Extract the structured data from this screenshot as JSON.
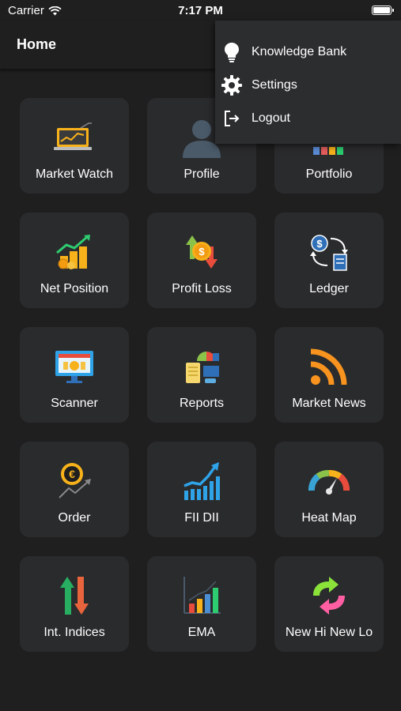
{
  "status_bar": {
    "carrier": "Carrier",
    "time": "7:17 PM"
  },
  "header": {
    "title": "Home"
  },
  "menu": {
    "items": [
      {
        "label": "Knowledge Bank",
        "icon": "lightbulb-icon"
      },
      {
        "label": "Settings",
        "icon": "gear-icon"
      },
      {
        "label": "Logout",
        "icon": "logout-icon"
      }
    ]
  },
  "tiles": [
    {
      "label": "Market Watch",
      "icon": "market-watch-icon"
    },
    {
      "label": "Profile",
      "icon": "profile-icon"
    },
    {
      "label": "Portfolio",
      "icon": "portfolio-icon"
    },
    {
      "label": "Net Position",
      "icon": "net-position-icon"
    },
    {
      "label": "Profit Loss",
      "icon": "profit-loss-icon"
    },
    {
      "label": "Ledger",
      "icon": "ledger-icon"
    },
    {
      "label": "Scanner",
      "icon": "scanner-icon"
    },
    {
      "label": "Reports",
      "icon": "reports-icon"
    },
    {
      "label": "Market News",
      "icon": "rss-icon"
    },
    {
      "label": "Order",
      "icon": "order-icon"
    },
    {
      "label": "FII DII",
      "icon": "fii-dii-icon"
    },
    {
      "label": "Heat Map",
      "icon": "heat-map-icon"
    },
    {
      "label": "Int. Indices",
      "icon": "int-indices-icon"
    },
    {
      "label": "EMA",
      "icon": "ema-icon"
    },
    {
      "label": "New Hi New Lo",
      "icon": "new-hi-new-lo-icon"
    }
  ],
  "colors": {
    "background": "#1f1f20",
    "tile": "#2a2b2d",
    "menu": "#2c2d2f",
    "accent_orange": "#f7931e",
    "accent_green": "#2ecc71",
    "accent_red": "#e74c3c",
    "accent_blue": "#2fa3e8"
  }
}
